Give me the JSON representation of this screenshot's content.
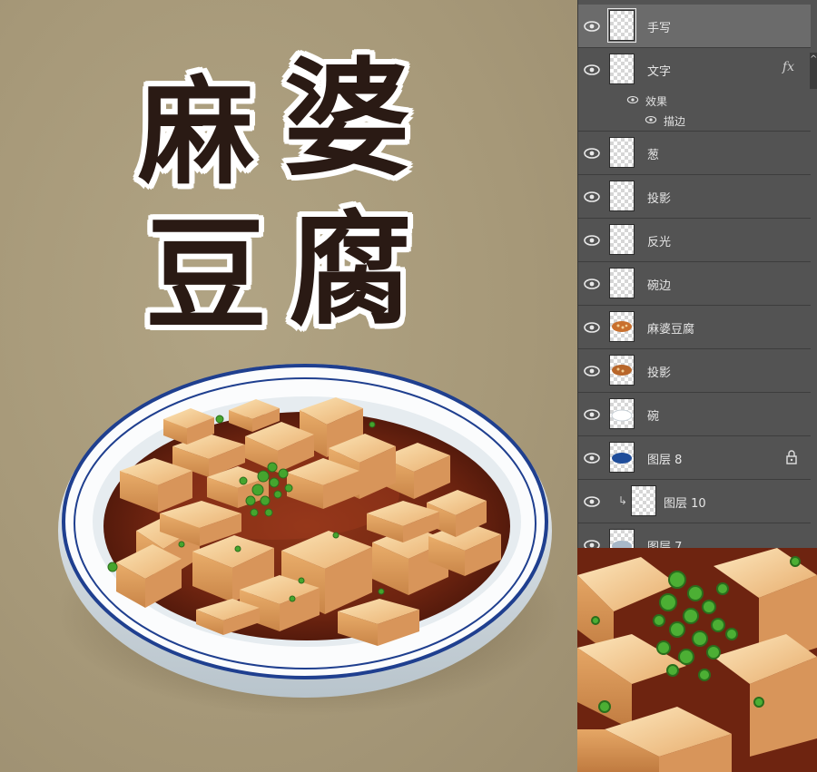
{
  "canvas": {
    "title_chars": [
      "麻",
      "豆",
      "婆",
      "腐"
    ]
  },
  "layers_panel": {
    "layers": [
      {
        "name": "手写",
        "selected": true,
        "thumb": "handwriting"
      },
      {
        "name": "文字",
        "selected": false,
        "thumb": "text",
        "fx": "fx"
      },
      {
        "name": "葱",
        "selected": false,
        "thumb": "blank"
      },
      {
        "name": "投影",
        "selected": false,
        "thumb": "blank"
      },
      {
        "name": "反光",
        "selected": false,
        "thumb": "blank"
      },
      {
        "name": "碗边",
        "selected": false,
        "thumb": "blank"
      },
      {
        "name": "麻婆豆腐",
        "selected": false,
        "thumb": "tofu"
      },
      {
        "name": "投影",
        "selected": false,
        "thumb": "tofu"
      },
      {
        "name": "碗",
        "selected": false,
        "thumb": "bowl"
      },
      {
        "name": "图层 8",
        "selected": false,
        "thumb": "blue-ellipse",
        "locked": true
      },
      {
        "name": "图层 10",
        "selected": false,
        "thumb": "blank",
        "clipped": true
      },
      {
        "name": "图层 7",
        "selected": false,
        "thumb": "grey"
      }
    ],
    "effects_label": "效果",
    "stroke_label": "描边"
  },
  "colors": {
    "panel_bg": "#535353",
    "selected_row": "#6b6b6b",
    "canvas_bg": "#a89a7c",
    "sauce": "#7a2a14",
    "tofu": "#f0c58a",
    "bowl_rim": "#1f3f8f",
    "scallion": "#3f9a2a"
  }
}
